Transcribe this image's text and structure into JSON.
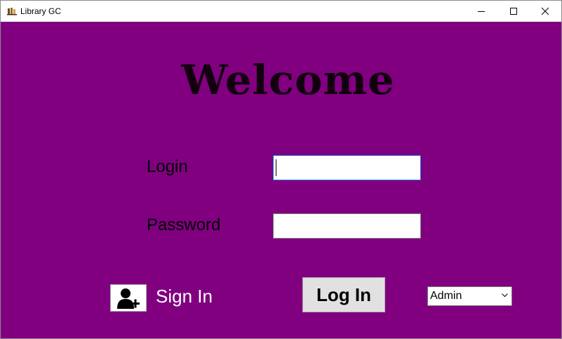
{
  "window": {
    "title": "Library GC",
    "controls": [
      "minimize-icon",
      "maximize-icon",
      "close-icon"
    ]
  },
  "welcome": {
    "heading": "Welcome"
  },
  "form": {
    "login_label": "Login",
    "login_value": "",
    "password_label": "Password",
    "password_value": ""
  },
  "actions": {
    "sign_in_icon": "add-user-icon",
    "sign_in_label": "Sign In",
    "log_in_label": "Log In"
  },
  "role": {
    "selected": "Admin"
  },
  "colors": {
    "background": "#800080",
    "heading": "#12000f",
    "focus_border": "#1a6fd6"
  }
}
